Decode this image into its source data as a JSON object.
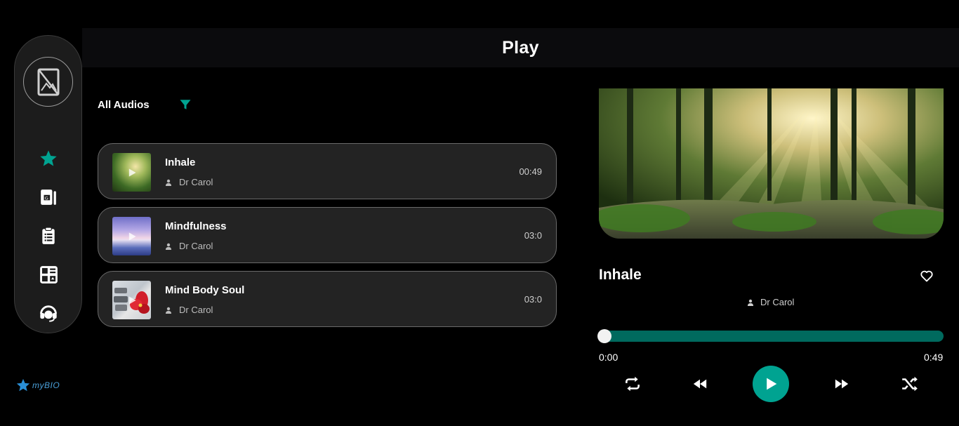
{
  "header": {
    "title": "Play"
  },
  "sidebar": {
    "items": [
      {
        "name": "home-star-icon",
        "color": "#00a391"
      },
      {
        "name": "workbook-icon"
      },
      {
        "name": "clipboard-icon"
      },
      {
        "name": "cards-icon"
      },
      {
        "name": "support-headset-icon"
      }
    ]
  },
  "logo": {
    "text": "myBIO"
  },
  "filter": {
    "label": "All Audios",
    "icon": "filter-icon"
  },
  "tracks": [
    {
      "title": "Inhale",
      "artist": "Dr Carol",
      "duration": "00:49"
    },
    {
      "title": "Mindfulness",
      "artist": "Dr Carol",
      "duration": "03:0"
    },
    {
      "title": "Mind Body Soul",
      "artist": "Dr Carol",
      "duration": "03:0"
    }
  ],
  "player": {
    "title": "Inhale",
    "artist": "Dr Carol",
    "current_time": "0:00",
    "total_time": "0:49",
    "progress": 0
  },
  "colors": {
    "accent": "#00a391",
    "track_bg": "#232323",
    "background": "#000000"
  }
}
